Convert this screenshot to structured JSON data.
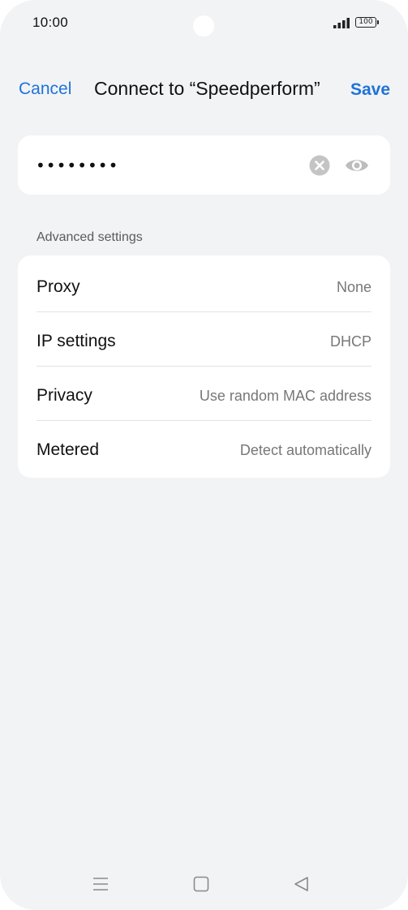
{
  "status_bar": {
    "time": "10:00",
    "battery_level": "100"
  },
  "header": {
    "cancel_label": "Cancel",
    "title": "Connect to “Speedperform”",
    "save_label": "Save"
  },
  "password": {
    "value": "••••••••",
    "clear_icon": "clear-circle-icon",
    "visibility_icon": "eye-icon"
  },
  "advanced": {
    "section_label": "Advanced settings",
    "rows": [
      {
        "label": "Proxy",
        "value": "None"
      },
      {
        "label": "IP settings",
        "value": "DHCP"
      },
      {
        "label": "Privacy",
        "value": "Use random MAC address"
      },
      {
        "label": "Metered",
        "value": "Detect automatically"
      }
    ]
  },
  "nav_bar": {
    "icons": [
      "menu-icon",
      "home-icon",
      "back-icon"
    ]
  },
  "colors": {
    "accent": "#1f73d8",
    "background": "#f2f3f5",
    "card": "#ffffff"
  }
}
